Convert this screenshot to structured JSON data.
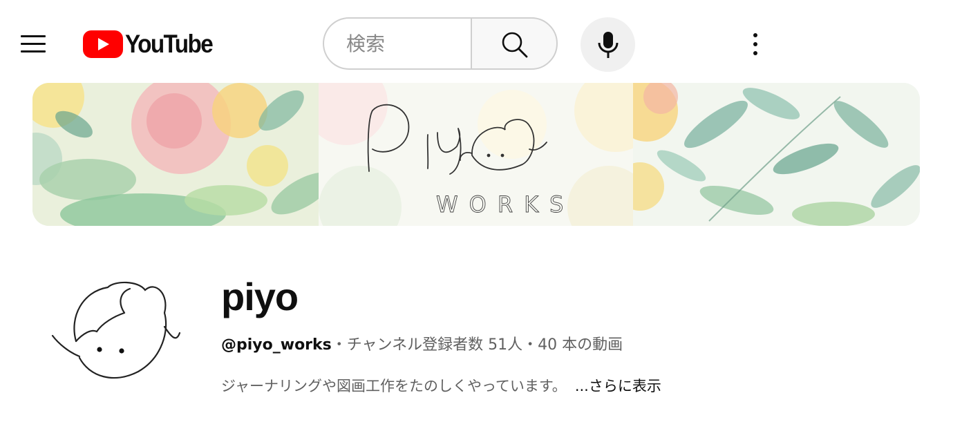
{
  "header": {
    "menu_icon": "hamburger-menu-icon",
    "logo": {
      "text": "YouTube",
      "brand_color": "#ff0000"
    },
    "search": {
      "placeholder": "検索",
      "value": "",
      "icon": "search-icon"
    },
    "voice_search_icon": "microphone-icon",
    "more_icon": "more-vertical-icon"
  },
  "banner": {
    "logo_text": "WORKS",
    "description": ""
  },
  "channel": {
    "name": "piyo",
    "handle": "@piyo_works",
    "separator": "・",
    "subscribers": "チャンネル登録者数 51人",
    "videos": "40 本の動画",
    "description": "ジャーナリングや図画工作をたのしくやっています。",
    "more_label": "...さらに表示"
  },
  "colors": {
    "text_primary": "#0f0f0f",
    "text_secondary": "#606060",
    "search_border": "#cfcfcf",
    "mic_bg": "#f0f0f0"
  }
}
